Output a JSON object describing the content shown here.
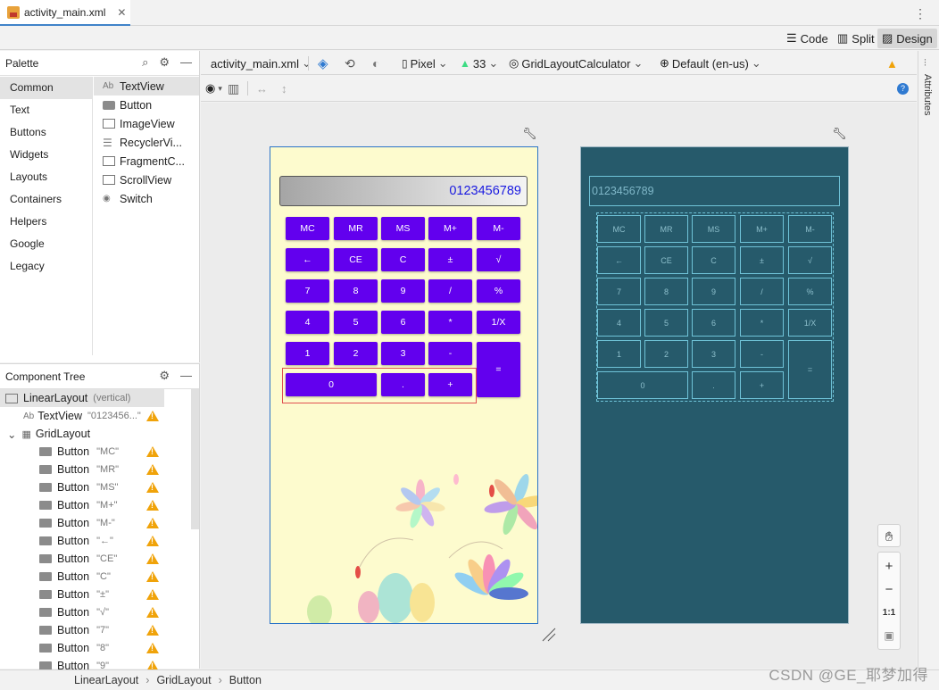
{
  "file_tab": {
    "label": "activity_main.xml"
  },
  "modes": [
    {
      "label": "Code"
    },
    {
      "label": "Split"
    },
    {
      "label": "Design"
    }
  ],
  "palette": {
    "title": "Palette",
    "categories": [
      "Common",
      "Text",
      "Buttons",
      "Widgets",
      "Layouts",
      "Containers",
      "Helpers",
      "Google",
      "Legacy"
    ],
    "widgets": [
      "TextView",
      "Button",
      "ImageView",
      "RecyclerVi...",
      "FragmentC...",
      "ScrollView",
      "Switch"
    ]
  },
  "component_tree": {
    "title": "Component Tree",
    "root": {
      "name": "LinearLayout",
      "sub": "(vertical)"
    },
    "textview": {
      "name": "TextView",
      "sub": "\"0123456...\""
    },
    "grid": {
      "name": "GridLayout"
    },
    "buttons": [
      "\"MC\"",
      "\"MR\"",
      "\"MS\"",
      "\"M+\"",
      "\"M-\"",
      "\"←\"",
      "\"CE\"",
      "\"C\"",
      "\"±\"",
      "\"√\"",
      "\"7\"",
      "\"8\"",
      "\"9\""
    ],
    "button_label": "Button"
  },
  "toolbar": {
    "file": "activity_main.xml",
    "device": "Pixel",
    "api": "33",
    "theme": "GridLayoutCalculator",
    "locale": "Default (en-us)"
  },
  "attributes_label": "Attributes",
  "calculator": {
    "display": "0123456789",
    "keys": [
      "MC",
      "MR",
      "MS",
      "M+",
      "M-",
      "←",
      "CE",
      "C",
      "±",
      "√",
      "7",
      "8",
      "9",
      "/",
      "%",
      "4",
      "5",
      "6",
      "*",
      "1/X",
      "1",
      "2",
      "3",
      "-",
      "=",
      "0",
      ".",
      "+"
    ],
    "colors": {
      "key": "#6200ee",
      "display_text": "#1a1ae0",
      "background": "#fdfbce",
      "blueprint": "#265a6b"
    }
  },
  "blueprint": {
    "display": "0123456789",
    "keys": [
      "MC",
      "MR",
      "MS",
      "M+",
      "M-",
      "←",
      "CE",
      "C",
      "±",
      "√",
      "7",
      "8",
      "9",
      "/",
      "%",
      "4",
      "5",
      "6",
      "*",
      "1/X",
      "1",
      "2",
      "3",
      "-",
      "0",
      ".",
      "+",
      "="
    ]
  },
  "zoom": {
    "fit": "1:1"
  },
  "breadcrumb": [
    "LinearLayout",
    "GridLayout",
    "Button"
  ],
  "watermark": "CSDN @GE_耶梦加得"
}
